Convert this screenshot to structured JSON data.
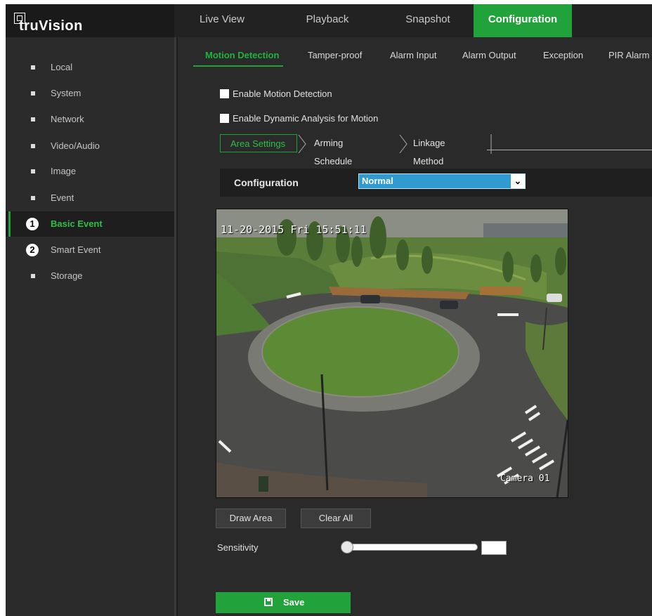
{
  "app": {
    "logo_text": "truVision"
  },
  "topnav": {
    "tabs": [
      "Live View",
      "Playback",
      "Snapshot",
      "Configuration"
    ],
    "active": "Configuration"
  },
  "sidebar": {
    "items": [
      {
        "label": "Local"
      },
      {
        "label": "System"
      },
      {
        "label": "Network"
      },
      {
        "label": "Video/Audio"
      },
      {
        "label": "Image"
      },
      {
        "label": "Event"
      },
      {
        "label": "Basic Event",
        "marker": "1",
        "active": true
      },
      {
        "label": "Smart Event",
        "marker": "2"
      },
      {
        "label": "Storage"
      }
    ]
  },
  "subtabs": [
    "Motion Detection",
    "Tamper-proof",
    "Alarm Input",
    "Alarm Output",
    "Exception",
    "PIR Alarm"
  ],
  "checkboxes": {
    "enable_motion": "Enable Motion Detection",
    "enable_dynamic": "Enable Dynamic Analysis for Motion"
  },
  "steps": [
    "Area Settings",
    "Arming Schedule",
    "Linkage Method"
  ],
  "config": {
    "label": "Configuration",
    "value": "Normal"
  },
  "video": {
    "timestamp": "11-20-2015  Fri 15:51:11",
    "camera_name": "Camera 01"
  },
  "buttons": {
    "draw_area": "Draw Area",
    "clear_all": "Clear All",
    "save": "Save"
  },
  "sensitivity": {
    "label": "Sensitivity",
    "value_fraction": 0.0
  },
  "colors": {
    "accent": "#21a23a",
    "select": "#2f9bd0"
  }
}
